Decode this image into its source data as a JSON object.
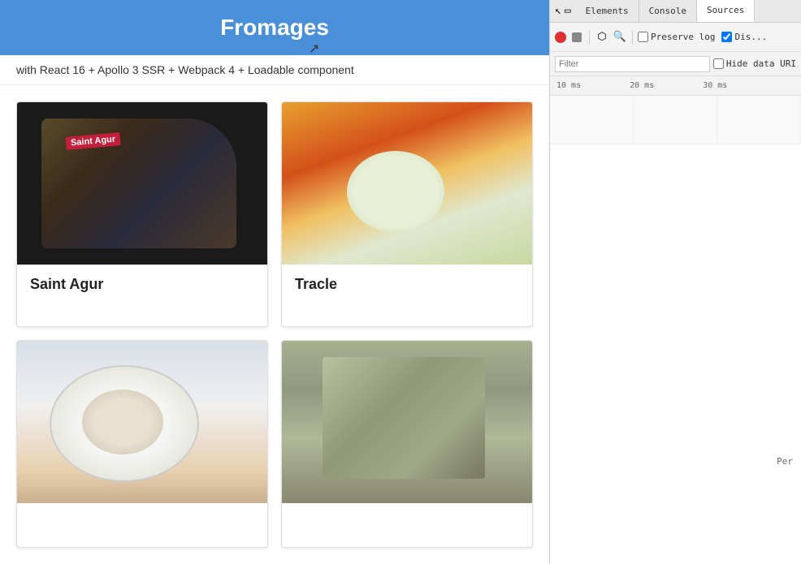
{
  "app": {
    "title": "Fromages",
    "subtitle": "with React 16 + Apollo 3 SSR + Webpack 4 + Loadable component"
  },
  "cheeses": [
    {
      "id": "saint-agur",
      "name": "Saint Agur",
      "imgClass": "cheese-img-saint-agur"
    },
    {
      "id": "tracle",
      "name": "Tracle",
      "imgClass": "cheese-img-tracle"
    },
    {
      "id": "third-cheese",
      "name": "",
      "imgClass": "cheese-img-third"
    },
    {
      "id": "fourth-cheese",
      "name": "",
      "imgClass": "cheese-img-fourth"
    }
  ],
  "devtools": {
    "tabs": [
      {
        "id": "elements",
        "label": "Elements"
      },
      {
        "id": "console",
        "label": "Console"
      },
      {
        "id": "sources",
        "label": "Sources"
      }
    ],
    "toolbar": {
      "preserve_log_label": "Preserve log",
      "disable_label": "Dis..."
    },
    "filter": {
      "placeholder": "Filter",
      "hide_data_url_label": "Hide data URI"
    },
    "timeline": {
      "markers": [
        "10 ms",
        "20 ms",
        "30 ms"
      ]
    },
    "network_content": {
      "per_label": "Per"
    },
    "icons": {
      "record": "record-icon",
      "stop": "stop-icon",
      "filter": "filter-icon",
      "search": "search-icon"
    }
  }
}
